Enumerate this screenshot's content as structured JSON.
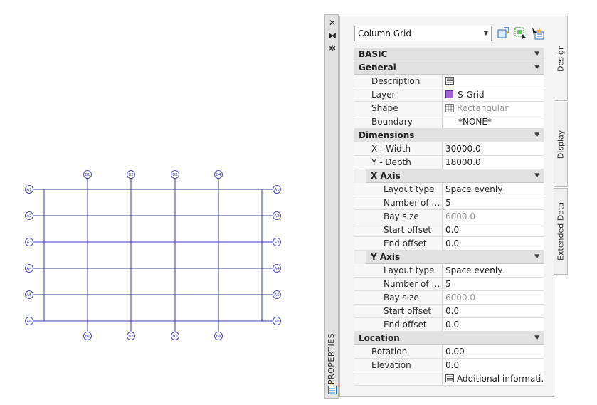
{
  "drawing": {
    "top_bubbles": [
      "B1",
      "B2",
      "B3",
      "B4"
    ],
    "bottom_bubbles": [
      "B1",
      "B2",
      "B3",
      "B4"
    ],
    "left_bubbles": [
      "A1",
      "A2",
      "A3",
      "A4",
      "A5",
      "A6"
    ],
    "right_bubbles": [
      "A1",
      "A2",
      "A3",
      "A4",
      "A5",
      "A6"
    ],
    "line_color": "#3b3bb0",
    "bubble_color": "#4a4ab8"
  },
  "palette": {
    "strip_title": "PROPERTIES",
    "style_selector": "Column Grid",
    "tabs": [
      "Design",
      "Display",
      "Extended Data"
    ],
    "sections": {
      "basic": "BASIC",
      "general": "General",
      "dimensions": "Dimensions",
      "x_axis": "X Axis",
      "y_axis": "Y Axis",
      "location": "Location"
    },
    "general": {
      "description_label": "Description",
      "layer_label": "Layer",
      "layer_value": "S-Grid",
      "shape_label": "Shape",
      "shape_value": "Rectangular",
      "boundary_label": "Boundary",
      "boundary_value": "*NONE*"
    },
    "dimensions": {
      "x_width_label": "X - Width",
      "x_width_value": "30000.0",
      "y_depth_label": "Y - Depth",
      "y_depth_value": "18000.0"
    },
    "x_axis": {
      "layout_type_label": "Layout type",
      "layout_type_value": "Space evenly",
      "num_bays_label": "Number of b...",
      "num_bays_value": "5",
      "bay_size_label": "Bay size",
      "bay_size_value": "6000.0",
      "start_offset_label": "Start offset",
      "start_offset_value": "0.0",
      "end_offset_label": "End offset",
      "end_offset_value": "0.0"
    },
    "y_axis": {
      "layout_type_label": "Layout type",
      "layout_type_value": "Space evenly",
      "num_bays_label": "Number of b...",
      "num_bays_value": "5",
      "bay_size_label": "Bay size",
      "bay_size_value": "6000.0",
      "start_offset_label": "Start offset",
      "start_offset_value": "0.0",
      "end_offset_label": "End offset",
      "end_offset_value": "0.0"
    },
    "location": {
      "rotation_label": "Rotation",
      "rotation_value": "0.00",
      "elevation_label": "Elevation",
      "elevation_value": "0.0",
      "additional_info": "Additional informati..."
    }
  }
}
